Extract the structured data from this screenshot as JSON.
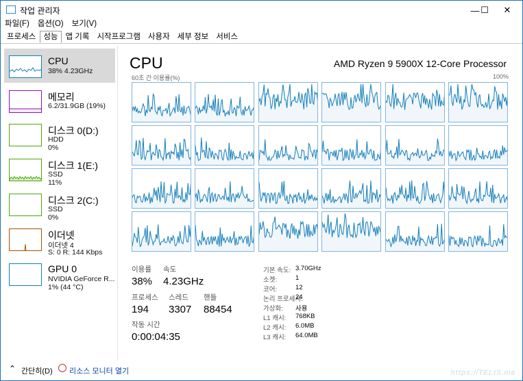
{
  "window": {
    "title": "작업 관리자",
    "minimize": "—",
    "maximize": "☐",
    "close": "✕"
  },
  "menu": [
    "파일(F)",
    "옵션(O)",
    "보기(V)"
  ],
  "tabs": [
    {
      "label": "프로세스",
      "active": false
    },
    {
      "label": "성능",
      "active": true
    },
    {
      "label": "앱 기록",
      "active": false
    },
    {
      "label": "시작프로그램",
      "active": false
    },
    {
      "label": "사용자",
      "active": false
    },
    {
      "label": "세부 정보",
      "active": false
    },
    {
      "label": "서비스",
      "active": false
    }
  ],
  "sidebar": {
    "items": [
      {
        "name": "CPU",
        "sub": [
          "38% 4.23GHz"
        ],
        "color": "#117dbb",
        "active": true
      },
      {
        "name": "메모리",
        "sub": [
          "6.2/31.9GB (19%)"
        ],
        "color": "#8b12ae",
        "active": false
      },
      {
        "name": "디스크 0(D:)",
        "sub": [
          "HDD",
          "0%"
        ],
        "color": "#4da60c",
        "active": false
      },
      {
        "name": "디스크 1(E:)",
        "sub": [
          "SSD",
          "11%"
        ],
        "color": "#4da60c",
        "active": false
      },
      {
        "name": "디스크 2(C:)",
        "sub": [
          "SSD",
          "0%"
        ],
        "color": "#4da60c",
        "active": false
      },
      {
        "name": "이더넷",
        "sub": [
          "이더넷 4",
          "S: 0 R: 144 Kbps"
        ],
        "color": "#a74f01",
        "active": false
      },
      {
        "name": "GPU 0",
        "sub": [
          "NVIDIA GeForce R...",
          "1% (44 °C)"
        ],
        "color": "#117dbb",
        "active": false
      }
    ]
  },
  "main": {
    "title": "CPU",
    "model": "AMD Ryzen 9 5900X 12-Core Processor",
    "graph_left_label": "60초 간 이용률(%)",
    "graph_right_label": "100%",
    "utilization_label": "이용률",
    "utilization_value": "38%",
    "speed_label": "속도",
    "speed_value": "4.23GHz",
    "processes_label": "프로세스",
    "processes_value": "194",
    "threads_label": "스레드",
    "threads_value": "3307",
    "handles_label": "핸들",
    "handles_value": "88454",
    "uptime_label": "작동 시간",
    "uptime_value": "0:00:04:35",
    "specs": [
      {
        "label": "기본 속도:",
        "value": "3.70GHz"
      },
      {
        "label": "소켓:",
        "value": "1"
      },
      {
        "label": "코어:",
        "value": "12"
      },
      {
        "label": "논리 프로세서:",
        "value": "24"
      },
      {
        "label": "가상화:",
        "value": "사용"
      },
      {
        "label": "L1 캐시:",
        "value": "768KB"
      },
      {
        "label": "L2 캐시:",
        "value": "6.0MB"
      },
      {
        "label": "L3 캐시:",
        "value": "64.0MB"
      }
    ]
  },
  "footer": {
    "fewer_details": "간단히(D)",
    "resource_monitor": "리소스 모니터 열기",
    "watermark": "https://TELIS.me"
  },
  "colors": {
    "cpu_line": "#117dbb",
    "cpu_fill": "#f1f6fa",
    "cell_border": "#7fb4de",
    "memory": "#8b12ae",
    "disk": "#4da60c",
    "ethernet": "#a74f01"
  }
}
